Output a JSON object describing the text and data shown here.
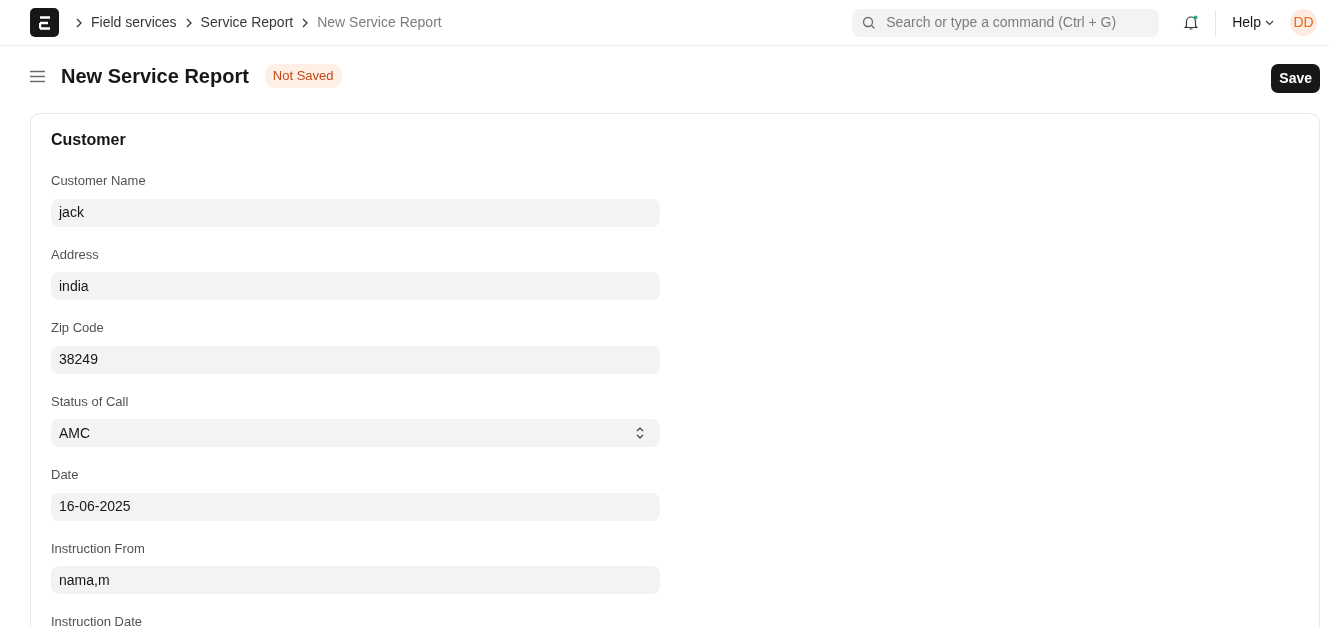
{
  "navbar": {
    "breadcrumbs": [
      {
        "label": "Field services",
        "current": false
      },
      {
        "label": "Service Report",
        "current": false
      },
      {
        "label": "New Service Report",
        "current": true
      }
    ],
    "search": {
      "placeholder": "Search or type a command (Ctrl + G)"
    },
    "notifications_unread": true,
    "help": "Help",
    "avatar": "DD"
  },
  "page": {
    "title": "New Service Report",
    "status": "Not Saved",
    "primary_action": "Save"
  },
  "section": {
    "title": "Customer",
    "fields": [
      {
        "label": "Customer Name",
        "kind": "text",
        "value": "jack"
      },
      {
        "label": "Address",
        "kind": "text",
        "value": "india"
      },
      {
        "label": "Zip Code",
        "kind": "text",
        "value": "38249"
      },
      {
        "label": "Status of Call",
        "kind": "select",
        "value": "AMC"
      },
      {
        "label": "Date",
        "kind": "text",
        "value": "16-06-2025"
      },
      {
        "label": "Instruction From",
        "kind": "text",
        "value": "nama,m"
      },
      {
        "label": "Instruction Date",
        "kind": "cut"
      }
    ]
  }
}
